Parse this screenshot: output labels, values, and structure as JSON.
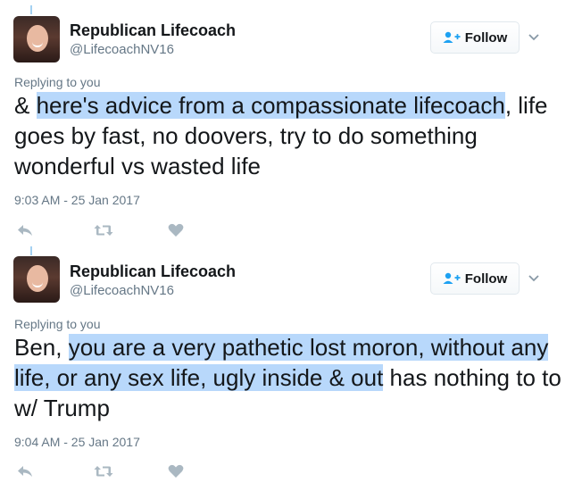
{
  "tweets": [
    {
      "author_name": "Republican Lifecoach",
      "author_handle": "@LifecoachNV16",
      "follow_label": "Follow",
      "replying_to": "Replying to you",
      "text_parts": [
        {
          "text": "& ",
          "highlight": false
        },
        {
          "text": "here's advice from a compassionate lifecoach",
          "highlight": true
        },
        {
          "text": ", life goes by fast, no doovers, try to do something wonderful vs wasted life",
          "highlight": false
        }
      ],
      "timestamp": "9:03 AM - 25 Jan 2017"
    },
    {
      "author_name": "Republican Lifecoach",
      "author_handle": "@LifecoachNV16",
      "follow_label": "Follow",
      "replying_to": "Replying to you",
      "text_parts": [
        {
          "text": "Ben, ",
          "highlight": false
        },
        {
          "text": "you are a very pathetic lost moron, without any life, or any sex life, ugly inside & out",
          "highlight": true
        },
        {
          "text": " has nothing to to w/ Trump",
          "highlight": false
        }
      ],
      "timestamp": "9:04 AM - 25 Jan 2017"
    }
  ],
  "colors": {
    "accent": "#1da1f2",
    "highlight": "#b8d8fb",
    "muted": "#657786",
    "action_icon": "#aab8c2"
  },
  "icons": [
    "reply-icon",
    "retweet-icon",
    "like-icon",
    "follow-user-icon",
    "chevron-down-icon"
  ]
}
